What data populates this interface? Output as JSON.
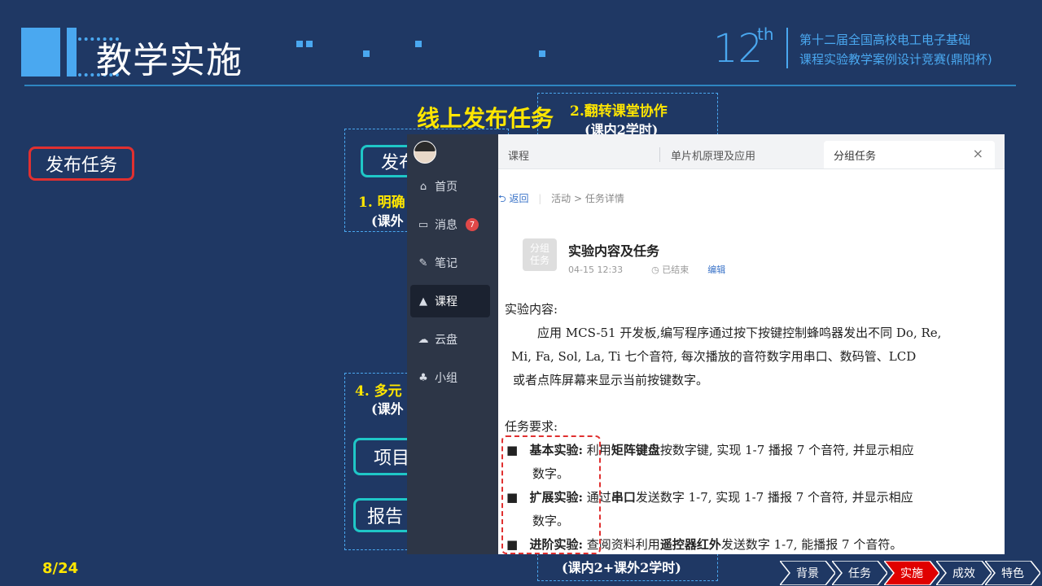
{
  "header": {
    "title": "教学实施",
    "edition_number": "12",
    "edition_suffix": "th",
    "competition_line1": "第十二届全国高校电工电子基础",
    "competition_line2": "课程实验教学案例设计竞赛(鼎阳杯)"
  },
  "left_button": "发布任务",
  "online_title": "线上发布任务",
  "steps": {
    "step2_title": "2.翻转课堂协作",
    "step2_sub": "(课内2学时)",
    "step1_title": "1. 明确",
    "step1_sub": "(课外",
    "step1_box": "发布",
    "step4_title": "4. 多元",
    "step4_sub": "(课外",
    "project_box": "项目",
    "report_box": "报告",
    "bottom_sub": "(课内2+课外2学时)"
  },
  "app": {
    "nav": [
      {
        "icon": "home-icon",
        "glyph": "⌂",
        "label": "首页"
      },
      {
        "icon": "message-icon",
        "glyph": "▭",
        "label": "消息",
        "badge": "7"
      },
      {
        "icon": "note-icon",
        "glyph": "✎",
        "label": "笔记"
      },
      {
        "icon": "course-icon",
        "glyph": "▲",
        "label": "课程"
      },
      {
        "icon": "cloud-icon",
        "glyph": "☁",
        "label": "云盘"
      },
      {
        "icon": "group-icon",
        "glyph": "♣",
        "label": "小组"
      }
    ],
    "tabs": [
      "课程",
      "单片机原理及应用",
      "分组任务"
    ],
    "close_glyph": "×",
    "back_label": "返回",
    "breadcrumb": "活动 > 任务详情",
    "task_icon_text": "分组\n任务",
    "task_title": "实验内容及任务",
    "task_date": "04-15 12:33",
    "task_status": "已结束",
    "task_edit": "编辑",
    "doc": {
      "content_heading": "实验内容:",
      "content_lines": [
        "应用 MCS-51 开发板,编写程序通过按下按键控制蜂鸣器发出不同 Do, Re,",
        "Mi, Fa, Sol, La, Ti 七个音符, 每次播放的音符数字用串口、数码管、LCD",
        "或者点阵屏幕来显示当前按键数字。"
      ],
      "req_heading": "任务要求:",
      "reqs": [
        {
          "label": "基本实验:",
          "pre": " 利用",
          "bold": "矩阵键盘",
          "post": "按数字键, 实现 1-7 播报 7 个音符, 并显示相应",
          "cont": "数字。"
        },
        {
          "label": "扩展实验:",
          "pre": " 通过",
          "bold": "串口",
          "post": "发送数字 1-7, 实现 1-7 播报 7 个音符, 并显示相应",
          "cont": "数字。"
        },
        {
          "label": "进阶实验:",
          "pre": " 查阅资料利用",
          "bold": "遥控器红外",
          "post": "发送数字 1-7, 能播报 7 个音符。",
          "cont": ""
        }
      ]
    }
  },
  "footer": {
    "page": "8/24",
    "nav": [
      "背景",
      "任务",
      "实施",
      "成效",
      "特色"
    ],
    "active_index": 2
  }
}
